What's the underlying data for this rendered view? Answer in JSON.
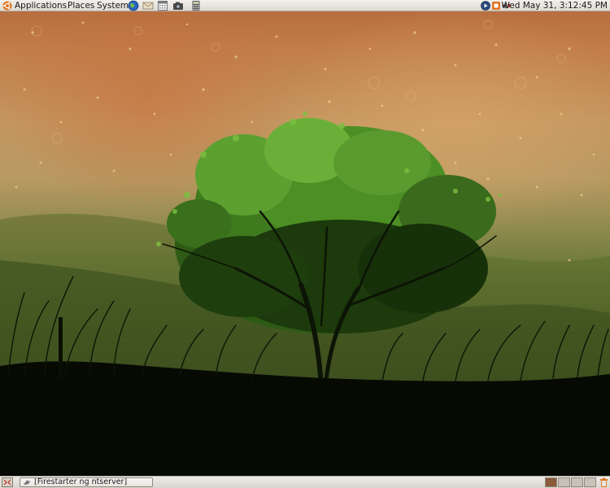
{
  "top_panel": {
    "menus": [
      "Applications",
      "Places",
      "System"
    ],
    "launchers": [
      {
        "icon": "web-browser-icon"
      },
      {
        "icon": "mail-client-icon"
      },
      {
        "icon": "calendar-icon"
      },
      {
        "icon": "camera-icon"
      },
      {
        "icon": "calculator-icon"
      }
    ],
    "tray": [
      {
        "icon": "media-player-icon"
      },
      {
        "icon": "update-notifier-icon"
      },
      {
        "icon": "volume-icon"
      }
    ],
    "clock": "Wed May 31,  3:12:45 PM"
  },
  "bottom_panel": {
    "show_desktop_icon": "show-desktop-icon",
    "tasks": [
      {
        "label": "[Firestarter ng  ntserver]",
        "icon": "firewall-app-icon"
      }
    ],
    "workspaces": {
      "count": 4,
      "active_index": 0
    },
    "trash_icon": "trash-icon"
  },
  "colors": {
    "panel": "#e8e5e0",
    "ubuntu_orange": "#e0741e",
    "active_workspace": "#8a5a3a"
  }
}
